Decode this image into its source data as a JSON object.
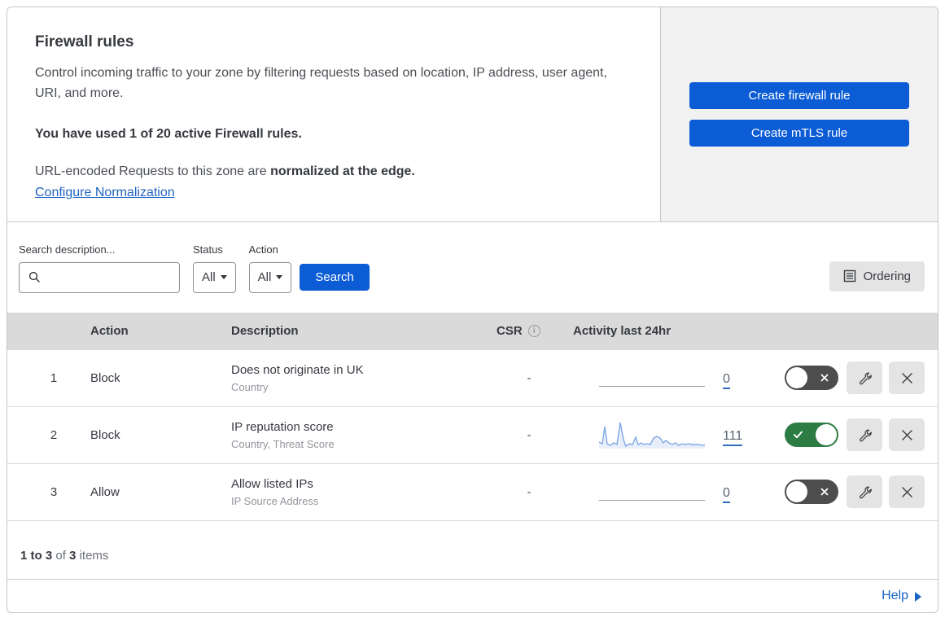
{
  "header": {
    "title": "Firewall rules",
    "description": "Control incoming traffic to your zone by filtering requests based on location, IP address, user agent, URI, and more.",
    "usage": "You have used 1 of 20 active Firewall rules.",
    "normalization_text": "URL-encoded Requests to this zone are ",
    "normalization_bold": "normalized at the edge.",
    "normalization_link": "Configure Normalization",
    "buttons": {
      "create_firewall": "Create firewall rule",
      "create_mtls": "Create mTLS rule"
    }
  },
  "filters": {
    "search_label": "Search description...",
    "status_label": "Status",
    "status_value": "All",
    "action_label": "Action",
    "action_value": "All",
    "search_button": "Search",
    "ordering_button": "Ordering"
  },
  "table": {
    "columns": {
      "action": "Action",
      "description": "Description",
      "csr": "CSR",
      "activity": "Activity last 24hr"
    },
    "rows": [
      {
        "num": "1",
        "action": "Block",
        "description": "Does not originate in UK",
        "criteria": "Country",
        "csr": "-",
        "count": "0",
        "enabled": false
      },
      {
        "num": "2",
        "action": "Block",
        "description": "IP reputation score",
        "criteria": "Country, Threat Score",
        "csr": "-",
        "count": "111",
        "enabled": true
      },
      {
        "num": "3",
        "action": "Allow",
        "description": "Allow listed IPs",
        "criteria": "IP Source Address",
        "csr": "-",
        "count": "0",
        "enabled": false
      }
    ]
  },
  "sparkline": {
    "row_index": 1,
    "width": 130,
    "height": 38,
    "stroke": "#7fa7e6",
    "fill": "rgba(127,167,230,0.18)",
    "points": [
      [
        0,
        28
      ],
      [
        4,
        30
      ],
      [
        7,
        9
      ],
      [
        10,
        30
      ],
      [
        14,
        32
      ],
      [
        18,
        29
      ],
      [
        22,
        31
      ],
      [
        26,
        4
      ],
      [
        30,
        25
      ],
      [
        33,
        33
      ],
      [
        37,
        30
      ],
      [
        41,
        31
      ],
      [
        45,
        22
      ],
      [
        48,
        31
      ],
      [
        52,
        29
      ],
      [
        55,
        31
      ],
      [
        59,
        30
      ],
      [
        63,
        31
      ],
      [
        67,
        23
      ],
      [
        71,
        21
      ],
      [
        75,
        23
      ],
      [
        79,
        29
      ],
      [
        82,
        26
      ],
      [
        86,
        29
      ],
      [
        90,
        31
      ],
      [
        94,
        29
      ],
      [
        98,
        32
      ],
      [
        102,
        30
      ],
      [
        106,
        31
      ],
      [
        110,
        30
      ],
      [
        114,
        31
      ],
      [
        118,
        31
      ],
      [
        122,
        31
      ],
      [
        126,
        32
      ],
      [
        130,
        31
      ]
    ]
  },
  "footer": {
    "range": "1 to 3",
    "of": "of",
    "total": "3",
    "items_label": "items",
    "help_label": "Help"
  },
  "colors": {
    "accent_blue": "#0b5cd5",
    "link_blue": "#1f62c1",
    "toggle_on_green": "#2c7c44",
    "toggle_off_gray": "#4d4d4d",
    "header_gray": "#dadada",
    "panel_gray": "#f1f1f1"
  },
  "icons": {
    "search": "magnifier",
    "csr_info": "i-in-circle",
    "ordering": "list-document",
    "edit": "wrench",
    "delete": "x",
    "toggle_on": "check",
    "toggle_off": "x",
    "help": "triangle-right",
    "dropdown": "triangle-down"
  }
}
